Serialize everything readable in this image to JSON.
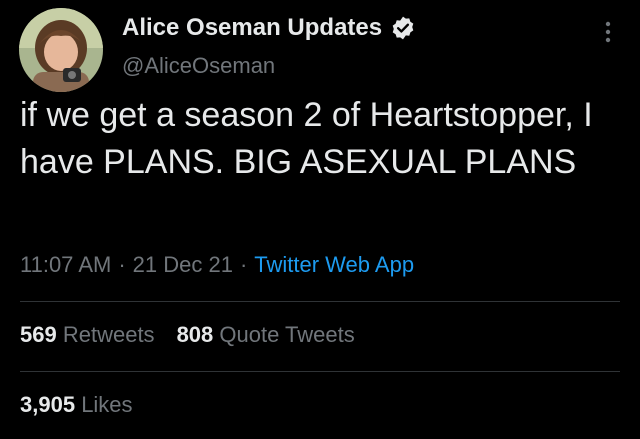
{
  "author": {
    "display_name": "Alice Oseman Updates",
    "handle": "@AliceOseman",
    "avatar_icon": "avatar-photo",
    "verified_icon": "verified-badge-icon"
  },
  "tweet": {
    "text": "if we get a season 2 of Heartstopper, I have PLANS. BIG ASEXUAL PLANS",
    "time": "11:07 AM",
    "date": "21 Dec 21",
    "separator": "·",
    "source": "Twitter Web App"
  },
  "stats": {
    "retweets_count": "569",
    "retweets_label": "Retweets",
    "quotes_count": "808",
    "quotes_label": "Quote Tweets",
    "likes_count": "3,905",
    "likes_label": "Likes"
  },
  "colors": {
    "background": "#000000",
    "text_primary": "#e7e9ea",
    "text_secondary": "#71767b",
    "link": "#1d9bf0",
    "divider": "#2f3336"
  }
}
